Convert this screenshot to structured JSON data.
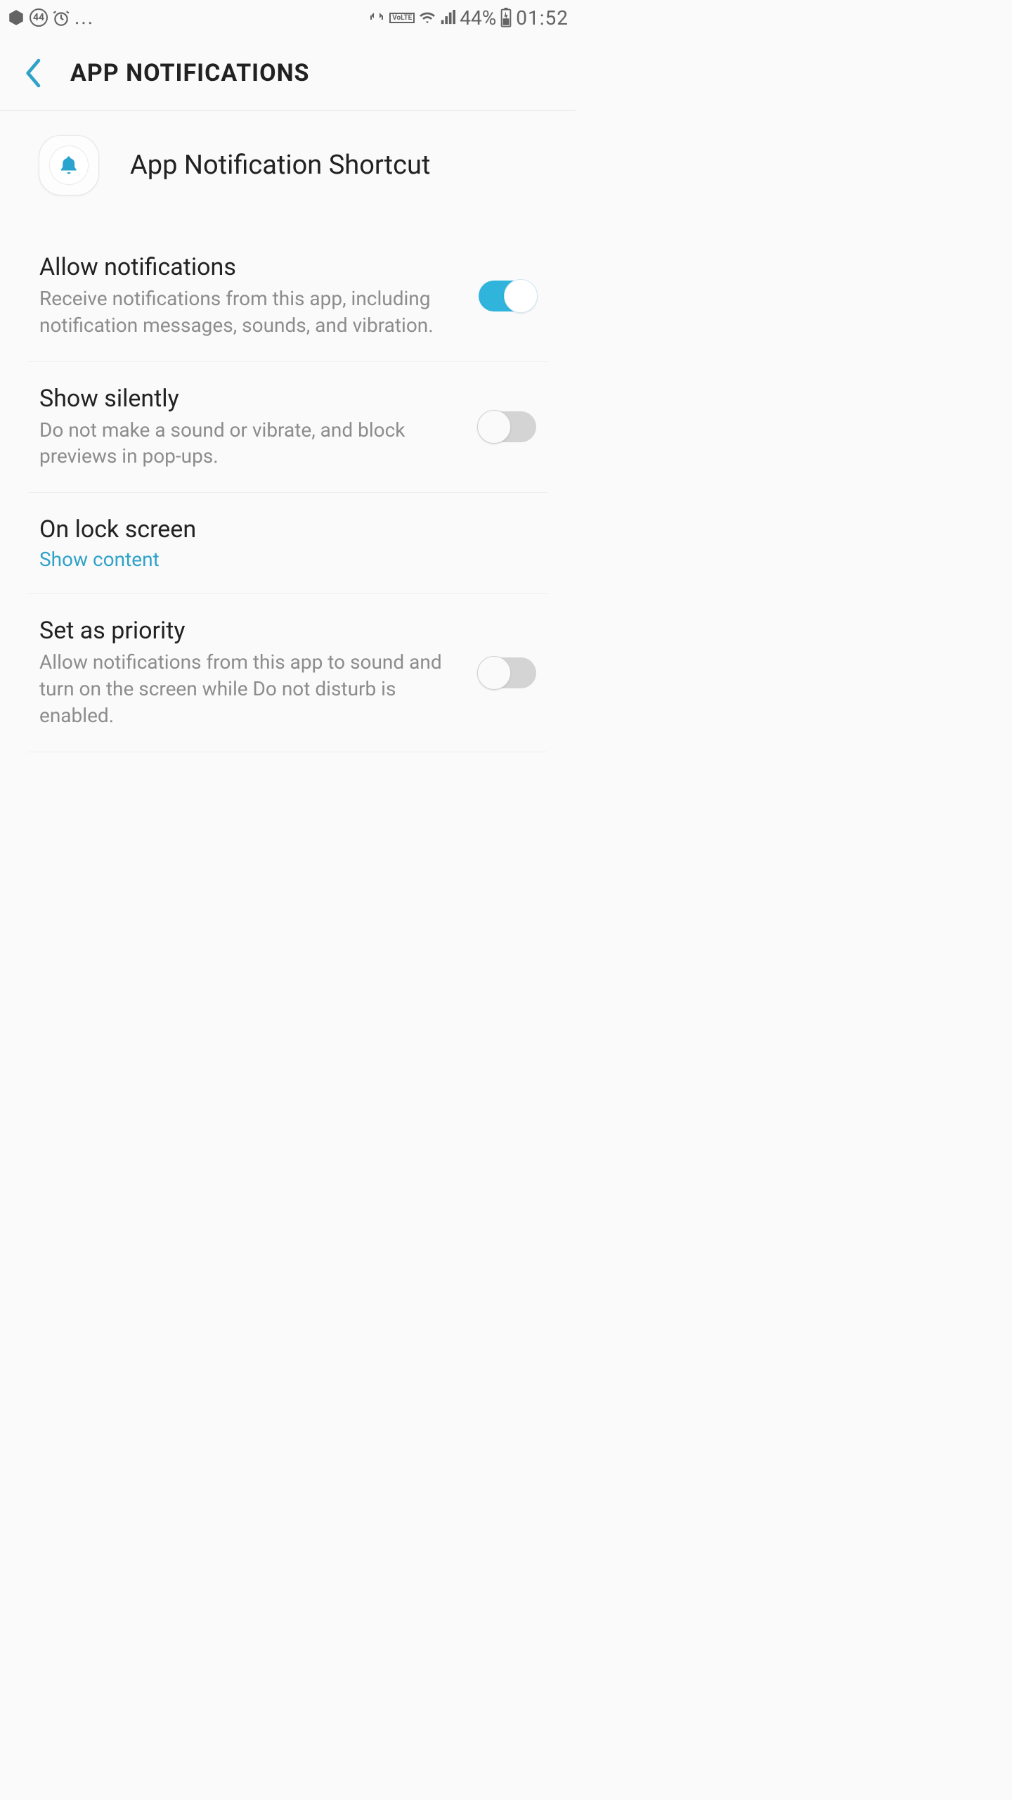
{
  "status_bar": {
    "left_icons": [
      "app-badge",
      "count-44",
      "alarm",
      "more"
    ],
    "battery_pct": "44%",
    "time": "01:52"
  },
  "header": {
    "title": "APP NOTIFICATIONS"
  },
  "app": {
    "name": "App Notification Shortcut"
  },
  "rows": {
    "allow": {
      "title": "Allow notifications",
      "desc": "Receive notifications from this app, including notification messages, sounds, and vibration.",
      "on": true
    },
    "silent": {
      "title": "Show silently",
      "desc": "Do not make a sound or vibrate, and block previews in pop-ups.",
      "on": false
    },
    "lock": {
      "title": "On lock screen",
      "value": "Show content"
    },
    "priority": {
      "title": "Set as priority",
      "desc": "Allow notifications from this app to sound and turn on the screen while Do not disturb is enabled.",
      "on": false
    }
  },
  "colors": {
    "accent": "#2fa2c8"
  }
}
